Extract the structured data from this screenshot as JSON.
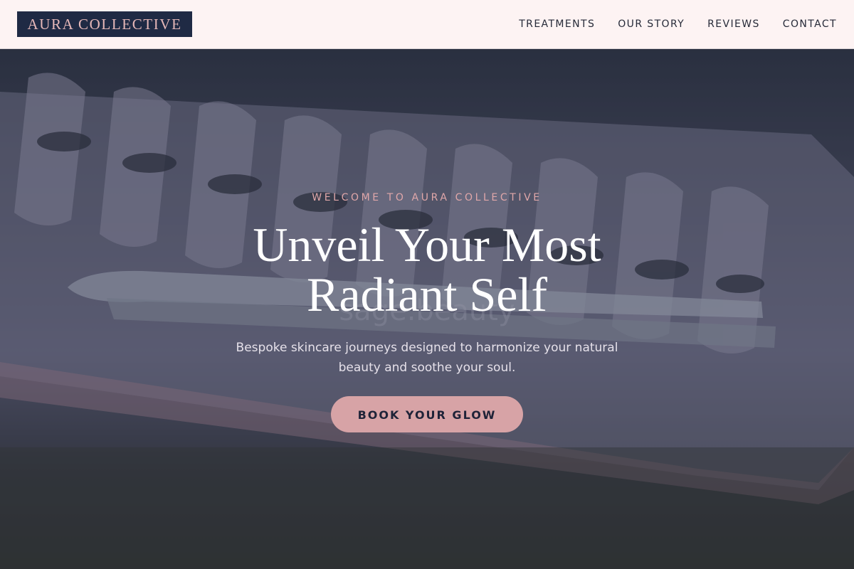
{
  "brand": {
    "name": "AURA COLLECTIVE",
    "primary_color": "#1f2a44",
    "accent_color": "#d7a3a6",
    "nav_background": "#fdf3f3"
  },
  "nav": {
    "items": [
      {
        "label": "TREATMENTS"
      },
      {
        "label": "OUR STORY"
      },
      {
        "label": "REVIEWS"
      },
      {
        "label": "CONTACT"
      }
    ]
  },
  "hero": {
    "eyebrow": "WELCOME TO AURA COLLECTIVE",
    "headline_line1": "Unveil Your Most",
    "headline_line2": "Radiant Self",
    "subtitle": "Bespoke skincare journeys designed to harmonize your natural beauty and soothe your soul.",
    "cta_label": "BOOK YOUR GLOW",
    "background_image": "eyelash extension tray with tweezers",
    "watermark_text": "sage.beauty"
  }
}
